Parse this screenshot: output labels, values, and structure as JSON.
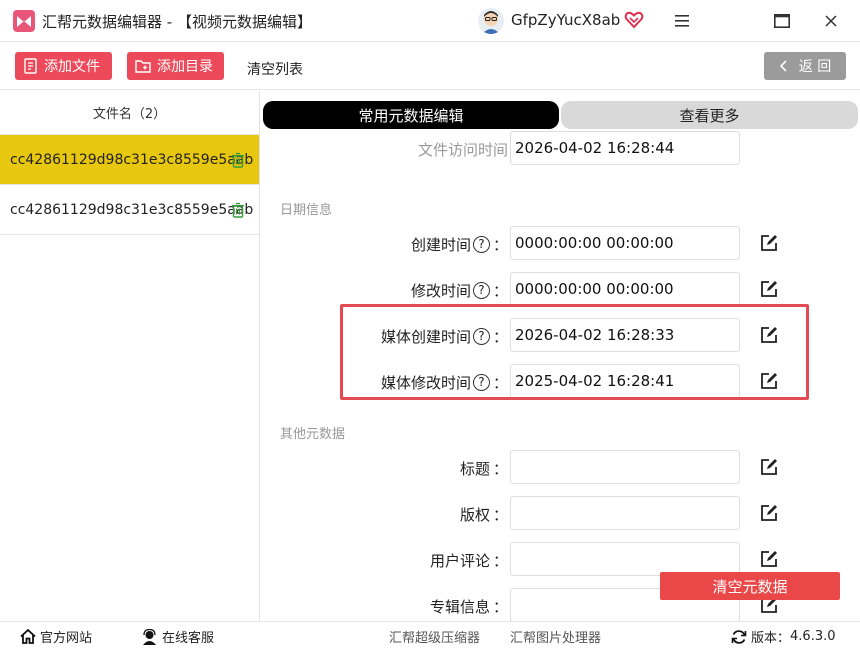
{
  "titlebar": {
    "app_title": "汇帮元数据编辑器 - 【视频元数据编辑】",
    "username": "GfpZyYucX8ab",
    "icons": [
      "app-logo",
      "avatar",
      "vip-heart-icon",
      "menu-icon",
      "maximize-icon",
      "close-icon"
    ]
  },
  "toolbar": {
    "add_file_label": "添加文件",
    "add_dir_label": "添加目录",
    "clear_list_label": "清空列表",
    "back_label": "返 回"
  },
  "sidebar": {
    "header": "文件名（2）",
    "files": [
      {
        "name": "cc42861129d98c31e3c8559e5aab",
        "selected": true
      },
      {
        "name": "cc42861129d98c31e3c8559e5aab",
        "selected": false
      }
    ]
  },
  "tabs": {
    "common_label": "常用元数据编辑",
    "more_label": "查看更多"
  },
  "form": {
    "access_time_label": "文件访问时间",
    "access_time_value": "2026-04-02 16:28:44",
    "date_section": "日期信息",
    "create_label": "创建时间",
    "create_value": "0000:00:00 00:00:00",
    "modify_label": "修改时间",
    "modify_value": "0000:00:00 00:00:00",
    "media_create_label": "媒体创建时间",
    "media_create_value": "2026-04-02 16:28:33",
    "media_modify_label": "媒体修改时间",
    "media_modify_value": "2025-04-02 16:28:41",
    "other_section": "其他元数据",
    "title_label": "标题",
    "title_value": "",
    "copyright_label": "版权",
    "copyright_value": "",
    "comment_label": "用户评论",
    "comment_value": "",
    "album_label": "专辑信息",
    "album_value": "",
    "colon": "：",
    "help_glyph": "?"
  },
  "actions": {
    "clear_meta_label": "清空元数据"
  },
  "statusbar": {
    "website": "官方网站",
    "service": "在线客服",
    "compressor": "汇帮超级压缩器",
    "image_tool": "汇帮图片处理器",
    "version_label": "版本：",
    "version_value": "4.6.3.0"
  },
  "colors": {
    "accent_red": "#ec4a5a",
    "selected_yellow": "#e8c70f",
    "highlight_red": "#e24b52"
  }
}
